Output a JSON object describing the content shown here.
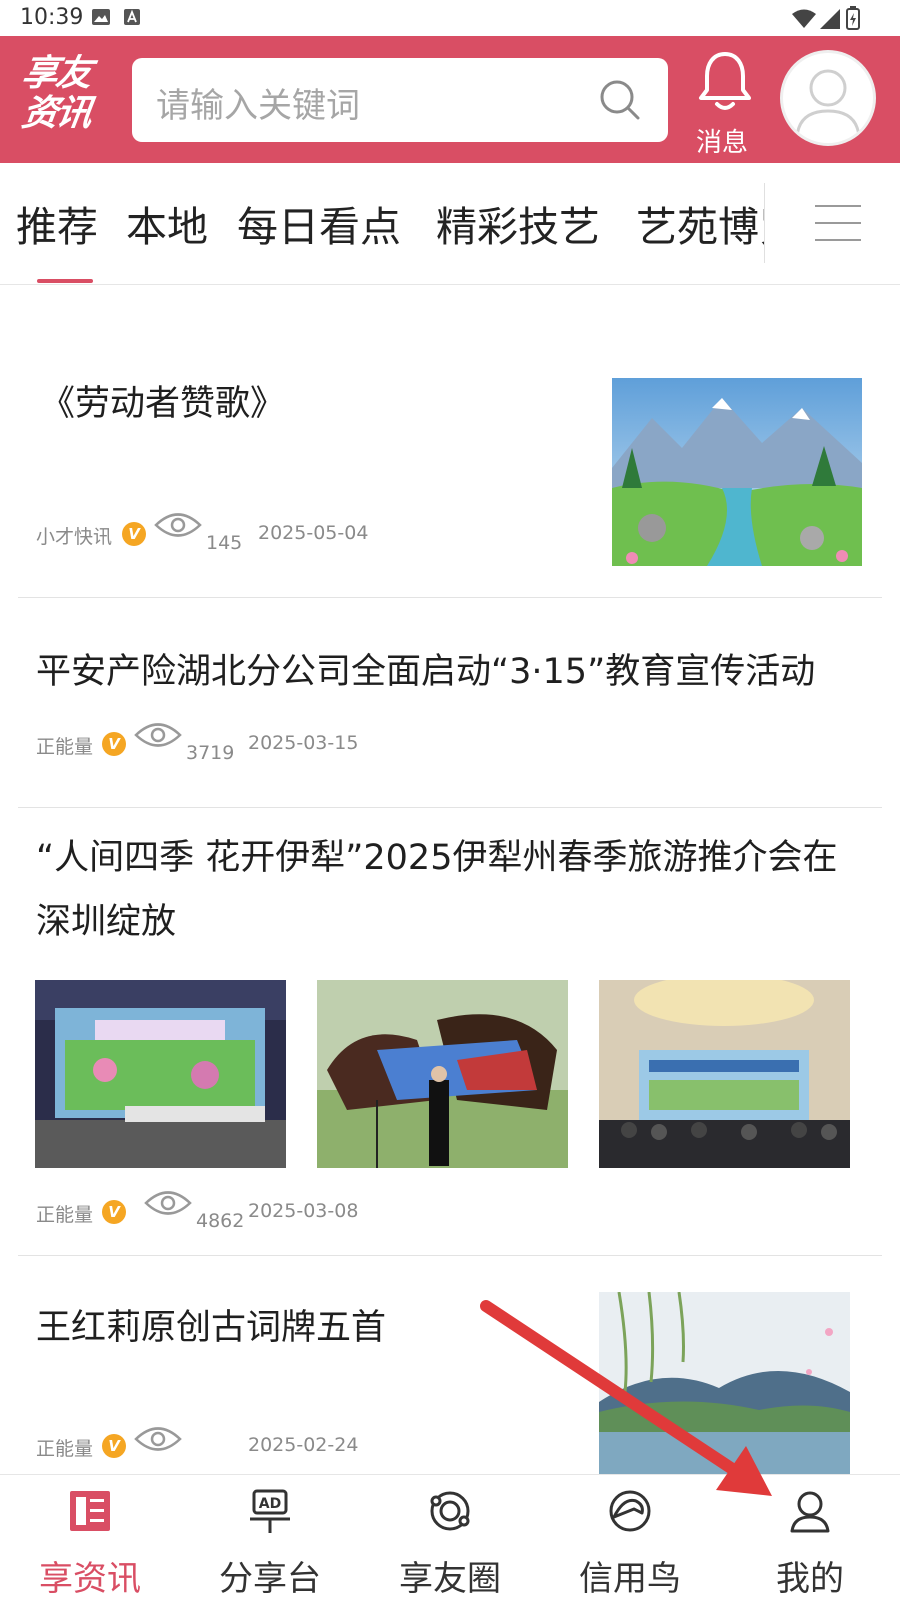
{
  "status_bar": {
    "time": "10:39"
  },
  "header": {
    "logo_line1": "享友",
    "logo_line2": "资讯",
    "search_placeholder": "请输入关键词",
    "message_label": "消息"
  },
  "tabs": [
    {
      "label": "推荐",
      "active": true
    },
    {
      "label": "本地"
    },
    {
      "label": "每日看点"
    },
    {
      "label": "精彩技艺"
    },
    {
      "label": "艺苑博览"
    }
  ],
  "articles": [
    {
      "title": "《劳动者赞歌》",
      "source": "小才快讯",
      "views": "145",
      "date": "2025-05-04"
    },
    {
      "title": "平安产险湖北分公司全面启动“3·15”教育宣传活动",
      "source": "正能量",
      "views": "3719",
      "date": "2025-03-15"
    },
    {
      "title": "“人间四季 花开伊犁”2025伊犁州春季旅游推介会在深圳绽放",
      "source": "正能量",
      "views": "4862",
      "date": "2025-03-08"
    },
    {
      "title": "王红莉原创古词牌五首",
      "source": "正能量",
      "views": "",
      "date": "2025-02-24"
    }
  ],
  "badge_text": "V",
  "bottom_nav": [
    {
      "label": "享资讯",
      "icon": "news-icon",
      "active": true
    },
    {
      "label": "分享台",
      "icon": "ad-board-icon"
    },
    {
      "label": "享友圈",
      "icon": "orbit-icon"
    },
    {
      "label": "信用鸟",
      "icon": "bird-icon"
    },
    {
      "label": "我的",
      "icon": "person-icon"
    }
  ],
  "colors": {
    "brand": "#d94e64",
    "annotation_arrow": "#e03a3a",
    "meta_text": "#8a8a8a"
  }
}
